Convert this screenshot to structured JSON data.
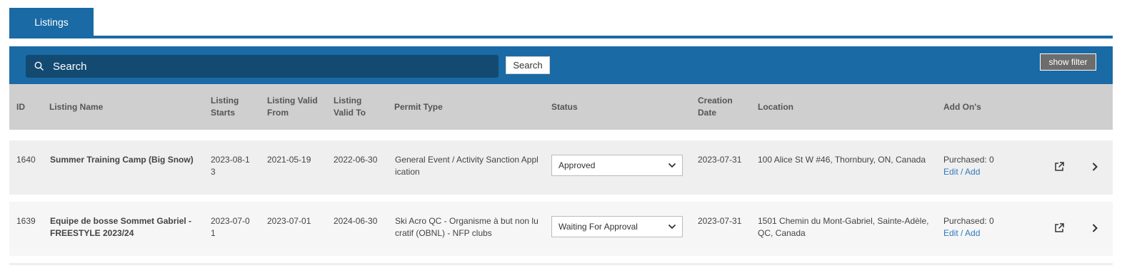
{
  "tabs": [
    {
      "label": "Listings",
      "active": true
    }
  ],
  "toolbar": {
    "search_placeholder": "Search",
    "search_button": "Search",
    "filter_button": "show filter"
  },
  "table": {
    "headers": {
      "id": "ID",
      "name": "Listing Name",
      "starts_1": "Listing",
      "starts_2": "Starts",
      "from_1": "Listing Valid",
      "from_2": "From",
      "to_1": "Listing",
      "to_2": "Valid To",
      "permit": "Permit Type",
      "status": "Status",
      "created_1": "Creation",
      "created_2": "Date",
      "location": "Location",
      "addons": "Add On's"
    },
    "rows": [
      {
        "id": "1640",
        "name_1": "Summer Training Camp (Big Snow)",
        "name_2": "",
        "starts_1": "2023-08-1",
        "starts_2": "3",
        "valid_from": "2021-05-19",
        "valid_to": "2022-06-30",
        "permit_1": "General Event / Activity Sanction Appl",
        "permit_2": "ication",
        "status": "Approved",
        "created": "2023-07-31",
        "location_1": "100 Alice St W #46, Thornbury, ON, Canada",
        "location_2": "",
        "purchased": "Purchased: 0",
        "edit_link": "Edit / Add"
      },
      {
        "id": "1639",
        "name_1": "Equipe de bosse Sommet Gabriel -",
        "name_2": "FREESTYLE 2023/24",
        "starts_1": "2023-07-0",
        "starts_2": "1",
        "valid_from": "2023-07-01",
        "valid_to": "2024-06-30",
        "permit_1": "Ski Acro QC - Organisme à but non lu",
        "permit_2": "cratif (OBNL) - NFP clubs",
        "status": "Waiting For Approval",
        "created": "2023-07-31",
        "location_1": "1501 Chemin du Mont-Gabriel, Sainte-Adèle,",
        "location_2": "QC, Canada",
        "purchased": "Purchased: 0",
        "edit_link": "Edit / Add"
      }
    ]
  },
  "icons": [
    "search-icon",
    "chevron-down-icon",
    "external-link-icon",
    "chevron-right-icon"
  ],
  "colors": {
    "primary": "#1a6aa5",
    "search_bg": "#134a72",
    "header_bg": "#cfcfcf",
    "link": "#2e7bbf"
  }
}
